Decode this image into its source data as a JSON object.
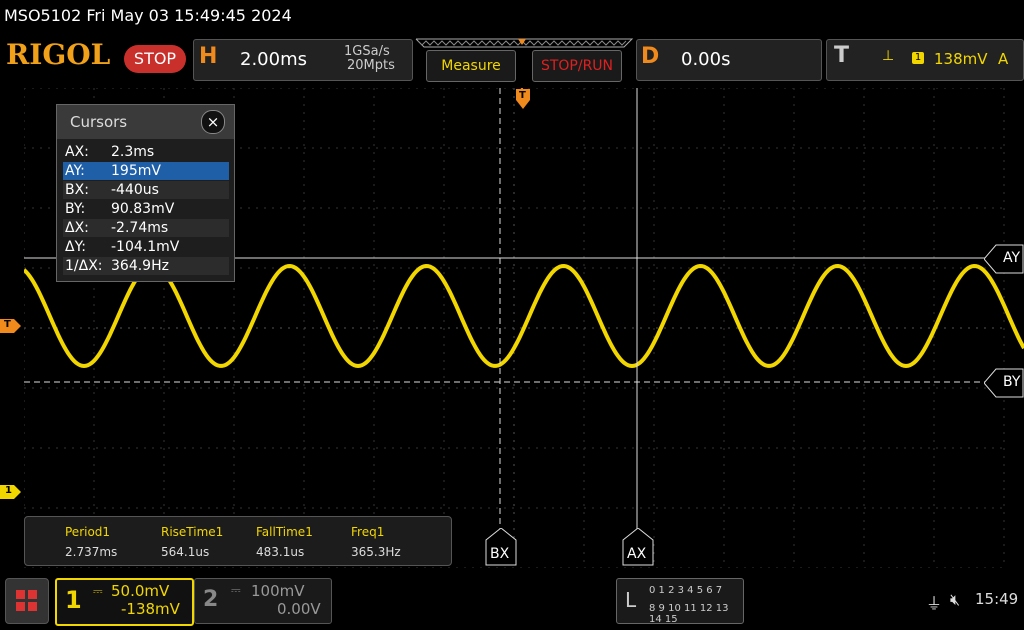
{
  "title_bar": {
    "text": "MSO5102  Fri May 03 15:49:45 2024"
  },
  "header": {
    "logo": "RIGOL",
    "run_state": "STOP",
    "horizontal": {
      "letter": "H",
      "timebase": "2.00ms",
      "sample_rate": "1GSa/s",
      "memory_depth": "20Mpts"
    },
    "measure_label": "Measure",
    "stop_run_label": "STOP/RUN",
    "delay": {
      "letter": "D",
      "value": "0.00s"
    },
    "trigger": {
      "letter": "T",
      "channel": "1",
      "level": "138mV",
      "mode": "A"
    }
  },
  "cursors": {
    "title": "Cursors",
    "close": "×",
    "rows": [
      {
        "key": "AX:",
        "value": "2.3ms"
      },
      {
        "key": "AY:",
        "value": "195mV"
      },
      {
        "key": "BX:",
        "value": "-440us"
      },
      {
        "key": "BY:",
        "value": "90.83mV"
      },
      {
        "key": "ΔX:",
        "value": "-2.74ms"
      },
      {
        "key": "ΔY:",
        "value": "-104.1mV"
      },
      {
        "key": "1/ΔX:",
        "value": "364.9Hz"
      }
    ],
    "labels": {
      "ay": "AY",
      "by": "BY",
      "bx": "BX",
      "ax": "AX"
    }
  },
  "markers": {
    "trigger_time": "T",
    "trigger_level": "T",
    "channel1": "1"
  },
  "measurements": [
    {
      "label": "Period1",
      "value": "2.737ms"
    },
    {
      "label": "RiseTime1",
      "value": "564.1us"
    },
    {
      "label": "FallTime1",
      "value": "483.1us"
    },
    {
      "label": "Freq1",
      "value": "365.3Hz"
    }
  ],
  "channels": {
    "ch1": {
      "number": "1",
      "scale": "50.0mV",
      "offset": "-138mV"
    },
    "ch2": {
      "number": "2",
      "scale": "100mV",
      "offset": "0.00V"
    }
  },
  "logic": {
    "letter": "L",
    "row1": "0 1 2 3  4 5 6 7",
    "row2": "8 9 10 11 12 13 14 15"
  },
  "status": {
    "time": "15:49"
  },
  "colors": {
    "ch1": "#f2d600",
    "accent": "#f08a1c",
    "stop": "#c9302c"
  },
  "waveform": {
    "frequency_hz": 365.3,
    "period_ms": 2.737
  }
}
